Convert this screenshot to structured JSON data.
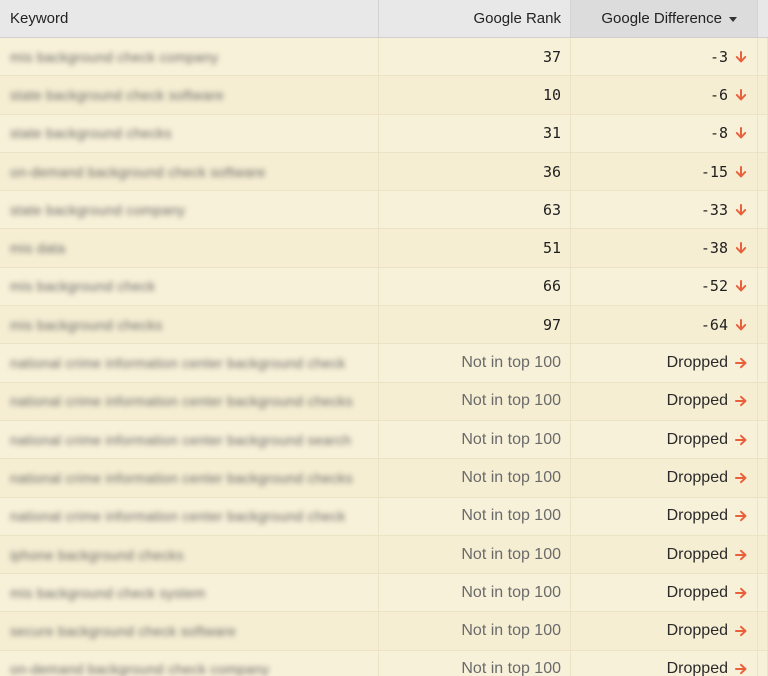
{
  "header": {
    "keyword": "Keyword",
    "rank": "Google Rank",
    "difference": "Google Difference"
  },
  "colors": {
    "header_bg": "#e8e8e8",
    "row_bg": "#f8f1d9",
    "arrow": "#e8603c"
  },
  "rows": [
    {
      "keyword": "mis background check company",
      "rank": "37",
      "diff": "-3",
      "direction": "down"
    },
    {
      "keyword": "state background check software",
      "rank": "10",
      "diff": "-6",
      "direction": "down"
    },
    {
      "keyword": "state background checks",
      "rank": "31",
      "diff": "-8",
      "direction": "down"
    },
    {
      "keyword": "on-demand background check software",
      "rank": "36",
      "diff": "-15",
      "direction": "down"
    },
    {
      "keyword": "state background company",
      "rank": "63",
      "diff": "-33",
      "direction": "down"
    },
    {
      "keyword": "mis data",
      "rank": "51",
      "diff": "-38",
      "direction": "down"
    },
    {
      "keyword": "mis background check",
      "rank": "66",
      "diff": "-52",
      "direction": "down"
    },
    {
      "keyword": "mis background checks",
      "rank": "97",
      "diff": "-64",
      "direction": "down"
    },
    {
      "keyword": "national crime information center background check",
      "rank": "Not in top 100",
      "diff": "Dropped",
      "direction": "right"
    },
    {
      "keyword": "national crime information center background checks",
      "rank": "Not in top 100",
      "diff": "Dropped",
      "direction": "right"
    },
    {
      "keyword": "national crime information center background search",
      "rank": "Not in top 100",
      "diff": "Dropped",
      "direction": "right"
    },
    {
      "keyword": "national crime information center background checks",
      "rank": "Not in top 100",
      "diff": "Dropped",
      "direction": "right"
    },
    {
      "keyword": "national crime information center background check",
      "rank": "Not in top 100",
      "diff": "Dropped",
      "direction": "right"
    },
    {
      "keyword": "iphone background checks",
      "rank": "Not in top 100",
      "diff": "Dropped",
      "direction": "right"
    },
    {
      "keyword": "mis background check system",
      "rank": "Not in top 100",
      "diff": "Dropped",
      "direction": "right"
    },
    {
      "keyword": "secure background check software",
      "rank": "Not in top 100",
      "diff": "Dropped",
      "direction": "right"
    },
    {
      "keyword": "on-demand background check company",
      "rank": "Not in top 100",
      "diff": "Dropped",
      "direction": "right"
    }
  ]
}
